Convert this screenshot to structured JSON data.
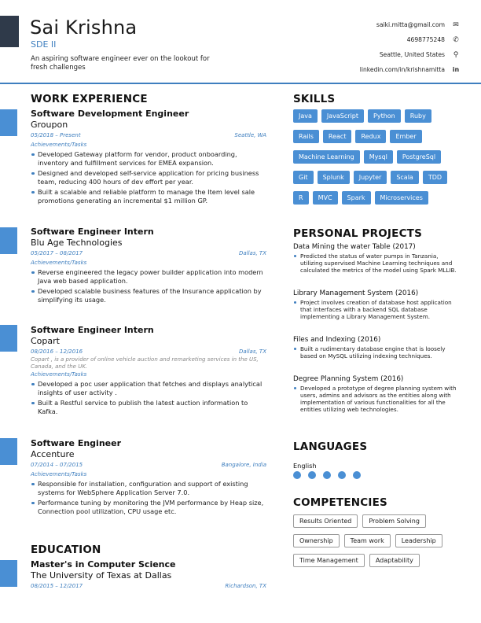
{
  "header": {
    "name": "Sai Krishna",
    "title": "SDE II",
    "summary": "An aspiring software engineer ever on the lookout for fresh challenges",
    "contacts": [
      {
        "text": "saiki.mitta@gmail.com",
        "icon": "envelope-icon",
        "glyph": "✉"
      },
      {
        "text": "4698775248",
        "icon": "phone-icon",
        "glyph": "✆"
      },
      {
        "text": "Seattle, United States",
        "icon": "location-pin-icon",
        "glyph": "⚲"
      },
      {
        "text": "linkedin.com/in/krishnamitta",
        "icon": "linkedin-icon",
        "glyph": "in"
      }
    ]
  },
  "colors": {
    "accent": "#3f7fbf",
    "tag": "#4a8fd4",
    "corner": "#2f3a4a"
  },
  "sections": {
    "work": "WORK EXPERIENCE",
    "education": "EDUCATION",
    "skills": "SKILLS",
    "projects": "PERSONAL PROJECTS",
    "languages": "LANGUAGES",
    "competencies": "COMPETENCIES"
  },
  "jobs": [
    {
      "title": "Software Development Engineer",
      "company": "Groupon",
      "dates": "05/2018 – Present",
      "location": "Seattle, WA",
      "subtitle": "Achievements/Tasks",
      "bullets": [
        "Developed Gateway platform for vendor, product onboarding, inventory and fulfillment services for EMEA expansion.",
        "Designed and developed self-service application for pricing business team, reducing 400 hours of dev effort per year.",
        "Built a scalable and reliable platform to manage the Item level sale promotions generating an incremental $1 million GP."
      ]
    },
    {
      "title": "Software Engineer Intern",
      "company": "Blu Age Technologies",
      "dates": "05/2017 – 08/2017",
      "location": "Dallas, TX",
      "subtitle": "Achievements/Tasks",
      "bullets": [
        "Reverse engineered the legacy power builder application into modern Java web based application.",
        "Developed scalable business features of the Insurance application by simplifying its usage."
      ]
    },
    {
      "title": "Software Engineer Intern",
      "company": "Copart",
      "dates": "08/2016 – 12/2016",
      "location": "Dallas, TX",
      "description": "Copart , is a provider of online vehicle auction and remarketing services in the US, Canada, and the UK.",
      "subtitle": "Achievements/Tasks",
      "bullets": [
        "Developed a poc user application that fetches and displays analytical insights of user activity .",
        "Built a Restful service to publish the latest auction information to Kafka."
      ]
    },
    {
      "title": "Software Engineer",
      "company": "Accenture",
      "dates": "07/2014 – 07/2015",
      "location": "Bangalore, India",
      "subtitle": "Achievements/Tasks",
      "bullets": [
        "Responsible for installation, configuration and support of existing systems for WebSphere Application Server 7.0.",
        "Performance tuning by monitoring the JVM performance by Heap size, Connection pool utilization, CPU usage etc."
      ]
    }
  ],
  "education": {
    "degree": "Master's in Computer Science",
    "school": "The University of Texas at Dallas",
    "dates": "08/2015 – 12/2017",
    "location": "Richardson, TX"
  },
  "skills": [
    "Java",
    "JavaScript",
    "Python",
    "Ruby",
    "Rails",
    "React",
    "Redux",
    "Ember",
    "Machine Learning",
    "Mysql",
    "PostgreSql",
    "Git",
    "Splunk",
    "Jupyter",
    "Scala",
    "TDD",
    "R",
    "MVC",
    "Spark",
    "Microservices"
  ],
  "projects": [
    {
      "title": "Data Mining the water Table (2017)",
      "bullet": "Predicted the status of water pumps in Tanzania, utilizing supervised Machine Learning techniques and calculated the metrics of the model using Spark MLLIB."
    },
    {
      "title": "Library Management System (2016)",
      "bullet": "Project involves creation of database host application that interfaces with a backend SQL database implementing a Library Management System."
    },
    {
      "title": "Files and Indexing (2016)",
      "bullet": "Built a rudimentary database engine that is loosely based on MySQL utilizing indexing techniques."
    },
    {
      "title": "Degree Planning System (2016)",
      "bullet": "Developed a prototype of degree planning system with users, admins and advisors as the entities along with implementation of various functionalities for all the entities utilizing web technologies."
    }
  ],
  "languages": [
    {
      "name": "English",
      "level": 5,
      "max": 5
    }
  ],
  "competencies": [
    "Results Oriented",
    "Problem Solving",
    "Ownership",
    "Team work",
    "Leadership",
    "Time Management",
    "Adaptability"
  ]
}
